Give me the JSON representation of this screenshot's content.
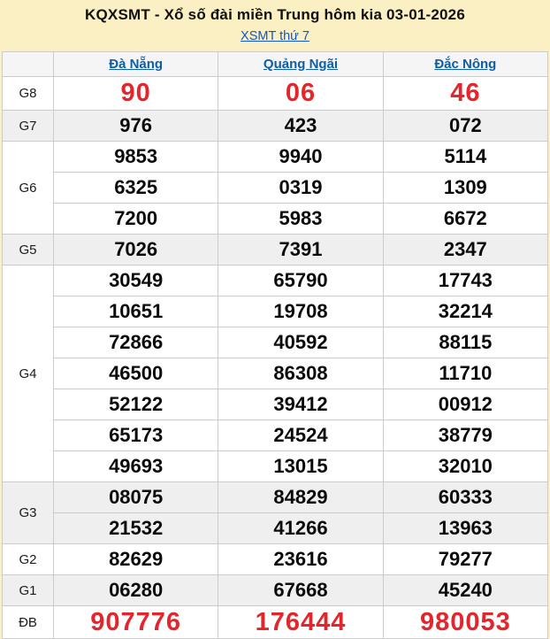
{
  "header": {
    "title": "KQXSMT - Xổ số đài miền Trung hôm kia 03-01-2026",
    "subtitle_link": "XSMT thứ 7"
  },
  "colors": {
    "page_bg": "#FBEFC4",
    "accent_red": "#E4262C",
    "column_header_blue": "#0D5EA8",
    "link_blue": "#1155CC",
    "band_gray": "#EFEFEF"
  },
  "table": {
    "columns": [
      "Đà Nẵng",
      "Quảng Ngãi",
      "Đắc Nông"
    ],
    "groups": [
      {
        "label": "G8",
        "cells": [
          [
            "90"
          ],
          [
            "06"
          ],
          [
            "46"
          ]
        ]
      },
      {
        "label": "G7",
        "cells": [
          [
            "976"
          ],
          [
            "423"
          ],
          [
            "072"
          ]
        ]
      },
      {
        "label": "G6",
        "cells": [
          [
            "9853",
            "6325",
            "7200"
          ],
          [
            "9940",
            "0319",
            "5983"
          ],
          [
            "5114",
            "1309",
            "6672"
          ]
        ]
      },
      {
        "label": "G5",
        "cells": [
          [
            "7026"
          ],
          [
            "7391"
          ],
          [
            "2347"
          ]
        ]
      },
      {
        "label": "G4",
        "cells": [
          [
            "30549",
            "10651",
            "72866",
            "46500",
            "52122",
            "65173",
            "49693"
          ],
          [
            "65790",
            "19708",
            "40592",
            "86308",
            "39412",
            "24524",
            "13015"
          ],
          [
            "17743",
            "32214",
            "88115",
            "11710",
            "00912",
            "38779",
            "32010"
          ]
        ]
      },
      {
        "label": "G3",
        "cells": [
          [
            "08075",
            "21532"
          ],
          [
            "84829",
            "41266"
          ],
          [
            "60333",
            "13963"
          ]
        ]
      },
      {
        "label": "G2",
        "cells": [
          [
            "82629"
          ],
          [
            "23616"
          ],
          [
            "79277"
          ]
        ]
      },
      {
        "label": "G1",
        "cells": [
          [
            "06280"
          ],
          [
            "67668"
          ],
          [
            "45240"
          ]
        ]
      },
      {
        "label": "ĐB",
        "cells": [
          [
            "907776"
          ],
          [
            "176444"
          ],
          [
            "980053"
          ]
        ]
      }
    ]
  }
}
